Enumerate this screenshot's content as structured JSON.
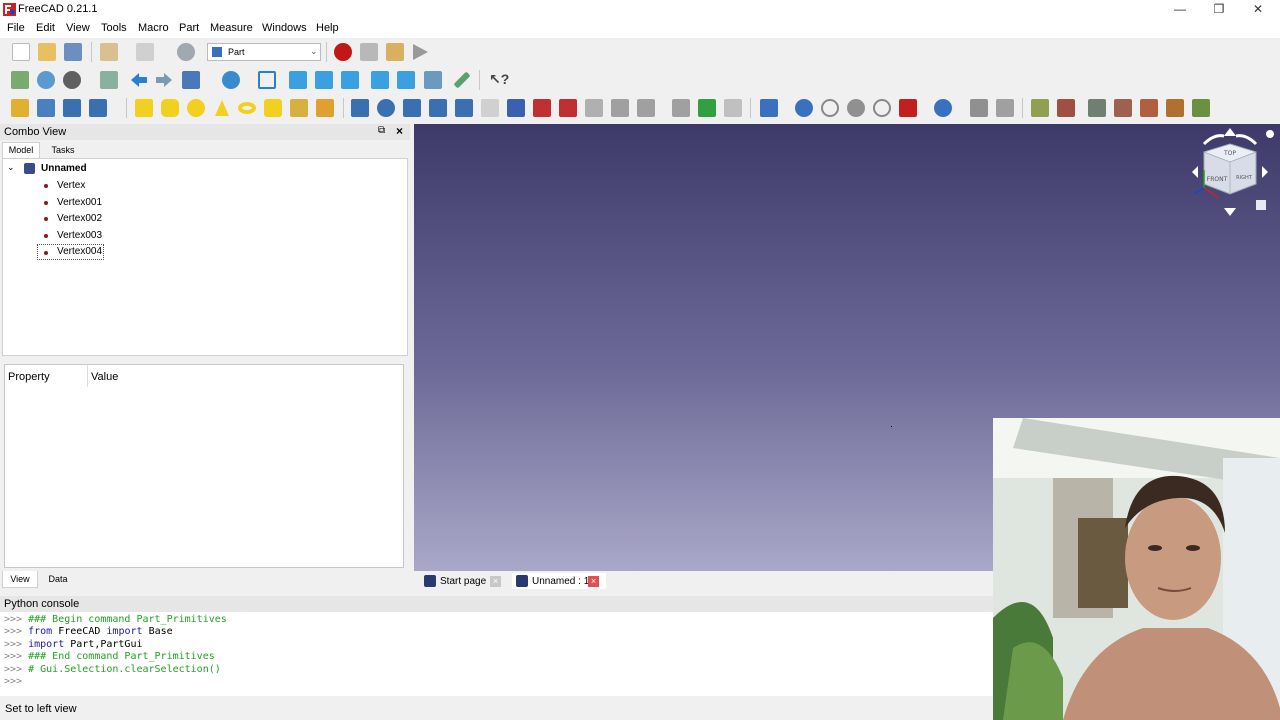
{
  "window": {
    "title": "FreeCAD 0.21.1",
    "controls": [
      "—",
      "❐",
      "✕"
    ]
  },
  "menu": [
    "File",
    "Edit",
    "View",
    "Tools",
    "Macro",
    "Part",
    "Measure",
    "Windows",
    "Help"
  ],
  "toolbar": {
    "workbench_selector": "Part"
  },
  "combo_view": {
    "title": "Combo View",
    "tabs": [
      "Model",
      "Tasks"
    ],
    "tree": {
      "root": "Unnamed",
      "items": [
        "Vertex",
        "Vertex001",
        "Vertex002",
        "Vertex003",
        "Vertex004"
      ]
    },
    "property_columns": [
      "Property",
      "Value"
    ],
    "bottom_tabs": [
      "View",
      "Data"
    ]
  },
  "document_tabs": [
    "Start page",
    "Unnamed : 1*"
  ],
  "python_console": {
    "title": "Python console",
    "lines": [
      {
        "prompt": ">>>",
        "text": "### Begin command Part_Primitives",
        "style": "cm"
      },
      {
        "prompt": ">>>",
        "text": "from FreeCAD import Base",
        "style": "mixed1"
      },
      {
        "prompt": ">>>",
        "text": "import Part,PartGui",
        "style": "mixed2"
      },
      {
        "prompt": ">>>",
        "text": "### End command Part_Primitives",
        "style": "cm"
      },
      {
        "prompt": ">>>",
        "text": "# Gui.Selection.clearSelection()",
        "style": "cm"
      },
      {
        "prompt": ">>>",
        "text": "",
        "style": "plain"
      }
    ]
  },
  "status": "Set to left view",
  "navcube": {
    "top": "TOP",
    "front": "FRONT",
    "right": "RIGHT"
  },
  "colors": {
    "view_top": "#3d3a6a",
    "view_bottom": "#aaa8c8",
    "accent_red": "#cc0000"
  }
}
